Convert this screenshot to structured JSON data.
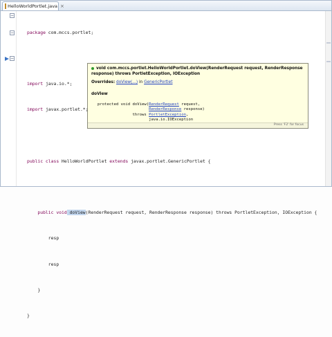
{
  "tab": {
    "label": "HelloWorldPortlet.java",
    "close": "×"
  },
  "code": {
    "package_kw": "package",
    "package_name": " com.mccs.portlet;",
    "import1_kw": "import",
    "import1_rest": " java.io.*;",
    "import2_kw": "import",
    "import2_rest": " javax.portlet.*;",
    "class_kw": "public class",
    "class_name": " HelloWorldPortlet ",
    "class_extends": "extends",
    "class_super": " javax.portlet.GenericPortlet {",
    "method_indent": "    ",
    "method_kw": "public void",
    "method_sel": " doView",
    "method_rest": "(RenderRequest request, RenderResponse response) throws PortletException, IOException {",
    "line_a": "        resp",
    "line_b": "        resp",
    "close_method": "    }",
    "close_class": "}"
  },
  "hover": {
    "signature": "void com.mccs.portlet.HelloWorldPortlet.doView(RenderRequest request, RenderResponse response) throws PortletException, IOException",
    "overrides_label": "Overrides:",
    "overrides_link": "doView(...)",
    "overrides_in": "in",
    "overrides_class": "GenericPortlet",
    "subheading": "doView",
    "sig1_pre": "protected void doView(",
    "sig1_type": "RenderRequest",
    "sig1_post": " request,",
    "sig2_type": "RenderResponse",
    "sig2_post": " response)",
    "sig3_pre": "throws ",
    "sig3_type": "PortletException",
    "sig3_post": ",",
    "sig4": "java.io.IOException",
    "footer": "Press 'F2' for focus"
  }
}
